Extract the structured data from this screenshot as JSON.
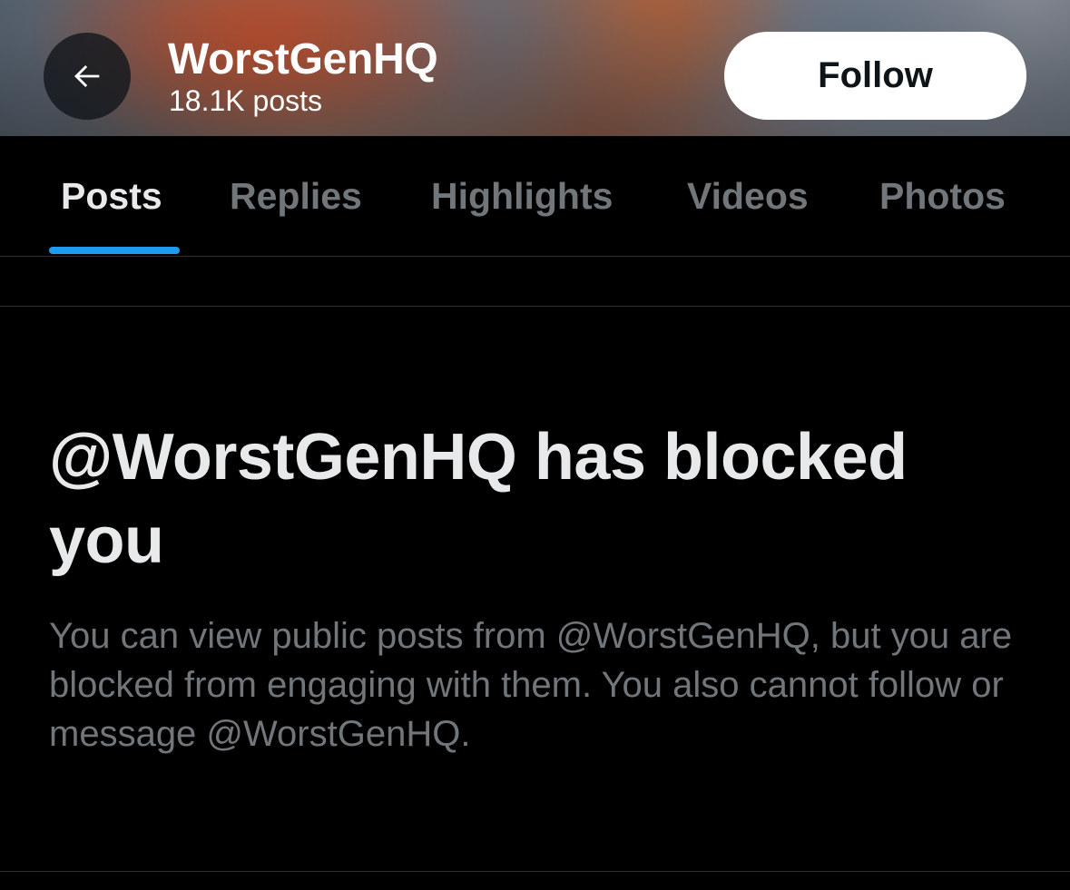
{
  "header": {
    "profile_name": "WorstGenHQ",
    "post_count": "18.1K posts",
    "follow_label": "Follow",
    "back_icon": "arrow-left-icon"
  },
  "tabs": [
    {
      "label": "Posts",
      "active": true
    },
    {
      "label": "Replies",
      "active": false
    },
    {
      "label": "Highlights",
      "active": false
    },
    {
      "label": "Videos",
      "active": false
    },
    {
      "label": "Photos",
      "active": false
    }
  ],
  "blocked": {
    "title": "@WorstGenHQ has blocked you",
    "body": "You can view public posts from @WorstGenHQ, but you are blocked from engaging with them. You also cannot follow or message @WorstGenHQ."
  },
  "colors": {
    "background": "#000000",
    "primary_text": "#e7e9ea",
    "secondary_text": "#71767b",
    "accent": "#1d9bf0",
    "divider": "#2f3336",
    "follow_bg": "#ffffff"
  }
}
